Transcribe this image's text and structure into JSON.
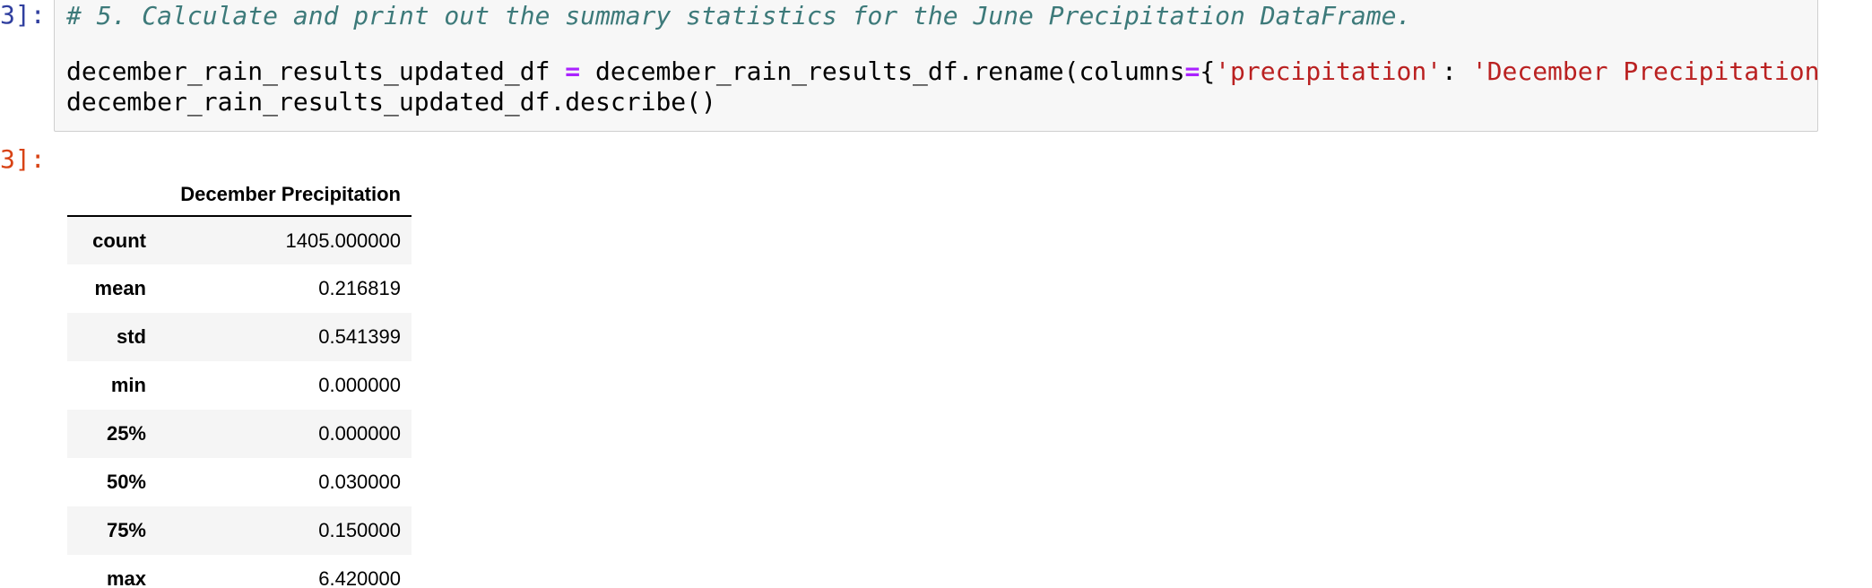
{
  "cell": {
    "in_prompt": "3]:",
    "out_prompt": "3]:",
    "code": {
      "comment": "# 5. Calculate and print out the summary statistics for the June Precipitation DataFrame.",
      "line2_var": "december_rain_results_updated_df ",
      "line2_op": "=",
      "line2_call": " december_rain_results_df.rename(columns",
      "line2_op2": "=",
      "line2_brace": "{",
      "line2_key": "'precipitation'",
      "line2_colon": ": ",
      "line2_val": "'December Precipitation",
      "line3": "december_rain_results_updated_df.describe()"
    }
  },
  "output_table": {
    "column_header": "December Precipitation",
    "rows": [
      {
        "label": "count",
        "value": "1405.000000"
      },
      {
        "label": "mean",
        "value": "0.216819"
      },
      {
        "label": "std",
        "value": "0.541399"
      },
      {
        "label": "min",
        "value": "0.000000"
      },
      {
        "label": "25%",
        "value": "0.000000"
      },
      {
        "label": "50%",
        "value": "0.030000"
      },
      {
        "label": "75%",
        "value": "0.150000"
      },
      {
        "label": "max",
        "value": "6.420000"
      }
    ]
  },
  "colors": {
    "in_prompt": "#303f9f",
    "out_prompt": "#d84315",
    "comment": "#3d7a7a",
    "operator": "#aa22ff",
    "string": "#ba2121",
    "code_background": "#f7f7f7"
  }
}
